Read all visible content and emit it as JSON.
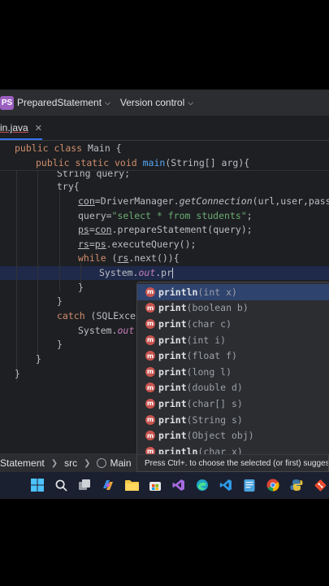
{
  "titlebar": {
    "project_badge": "PS",
    "project_name": "PreparedStatement",
    "version_control": "Version control"
  },
  "tabs": [
    {
      "label": "in.java"
    }
  ],
  "sticky": {
    "line1": {
      "kw1": "public",
      "kw2": "class",
      "name": "Main {"
    },
    "line2": {
      "kw1": "public",
      "kw2": "static",
      "kw3": "void",
      "fn": "main",
      "rest": "(String[] arg){"
    }
  },
  "code": {
    "l_try": "try{",
    "l_con_var": "con",
    "l_con_eq": "=DriverManager.",
    "l_con_fn": "getConnection",
    "l_con_args": "(url,user,passwo",
    "l_query_var": "query=",
    "l_query_str": "\"select * from students\"",
    "l_query_end": ";",
    "l_ps_var": "ps",
    "l_ps_eq": "=",
    "l_ps_con": "con",
    "l_ps_rest": ".prepareStatement(query);",
    "l_rs_var": "rs",
    "l_rs_eq": "=",
    "l_rs_ps": "ps",
    "l_rs_rest": ".executeQuery();",
    "l_while_kw": "while",
    "l_while_open": " (",
    "l_while_rs": "rs",
    "l_while_rest": ".next()){",
    "l_sys_cls": "System.",
    "l_sys_out": "out",
    "l_sys_typed": ".pr",
    "l_close1": "}",
    "l_close2": "}",
    "l_catch_kw": "catch",
    "l_catch_rest": " (SQLExcep",
    "l_sys2_cls": "System.",
    "l_sys2_out": "out",
    "l_sys2_dot": ".",
    "l_close3": "}",
    "l_close4": "}",
    "l_close5": "}",
    "l_string_partial": "String query;"
  },
  "completion": {
    "icon_letter": "m",
    "items": [
      {
        "name": "println",
        "params": "(int x)"
      },
      {
        "name": "print",
        "params": "(boolean b)"
      },
      {
        "name": "print",
        "params": "(char c)"
      },
      {
        "name": "print",
        "params": "(int i)"
      },
      {
        "name": "print",
        "params": "(float f)"
      },
      {
        "name": "print",
        "params": "(long l)"
      },
      {
        "name": "print",
        "params": "(double d)"
      },
      {
        "name": "print",
        "params": "(char[] s)"
      },
      {
        "name": "print",
        "params": "(String s)"
      },
      {
        "name": "print",
        "params": "(Object obj)"
      },
      {
        "name": "println",
        "params": "(char x)"
      }
    ],
    "hint": "Press Ctrl+. to choose the selected (or first) suggestion"
  },
  "statusbar": {
    "crumb1": "Statement",
    "crumb2": "src",
    "crumb3": "Main"
  },
  "taskbar": {
    "icons": [
      "windows-start-icon",
      "search-icon",
      "task-view-icon",
      "copilot-icon",
      "file-explorer-icon",
      "store-icon",
      "visual-studio-icon",
      "edge-icon",
      "vscode-icon",
      "notepad-icon",
      "chrome-icon",
      "python-icon",
      "git-icon"
    ]
  },
  "colors": {
    "ide_bg": "#1e1f22",
    "keyword": "#cf8e6d",
    "string": "#6aab73",
    "function": "#56a8f5",
    "field": "#c77dbb",
    "selection": "#2e436e",
    "method_icon": "#c75450"
  }
}
